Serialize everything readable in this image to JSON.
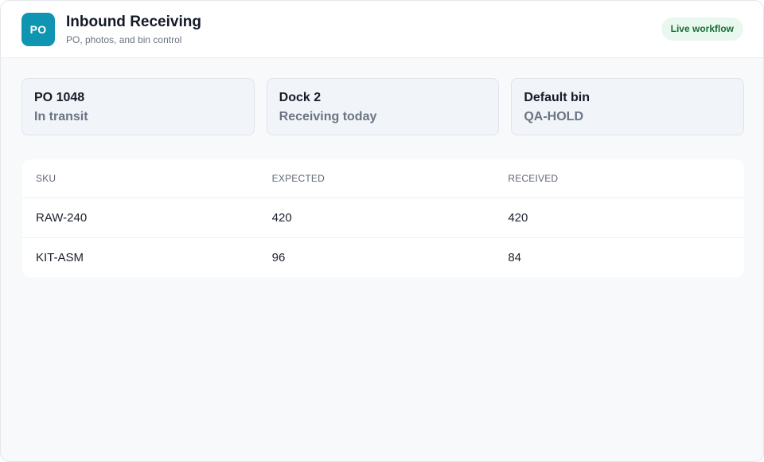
{
  "header": {
    "logo_text": "PO",
    "title": "Inbound Receiving",
    "subtitle": "PO, photos, and bin control",
    "badge": "Live workflow"
  },
  "cards": [
    {
      "title": "PO 1048",
      "value": "In transit"
    },
    {
      "title": "Dock 2",
      "value": "Receiving today"
    },
    {
      "title": "Default bin",
      "value": "QA-HOLD"
    }
  ],
  "table": {
    "columns": [
      "SKU",
      "EXPECTED",
      "RECEIVED"
    ],
    "rows": [
      [
        "RAW-240",
        "420",
        "420"
      ],
      [
        "KIT-ASM",
        "96",
        "84"
      ]
    ]
  },
  "colors": {
    "accent": "#0f94b1",
    "badge_bg": "#e9f8ef",
    "badge_text": "#1b6b3a"
  }
}
